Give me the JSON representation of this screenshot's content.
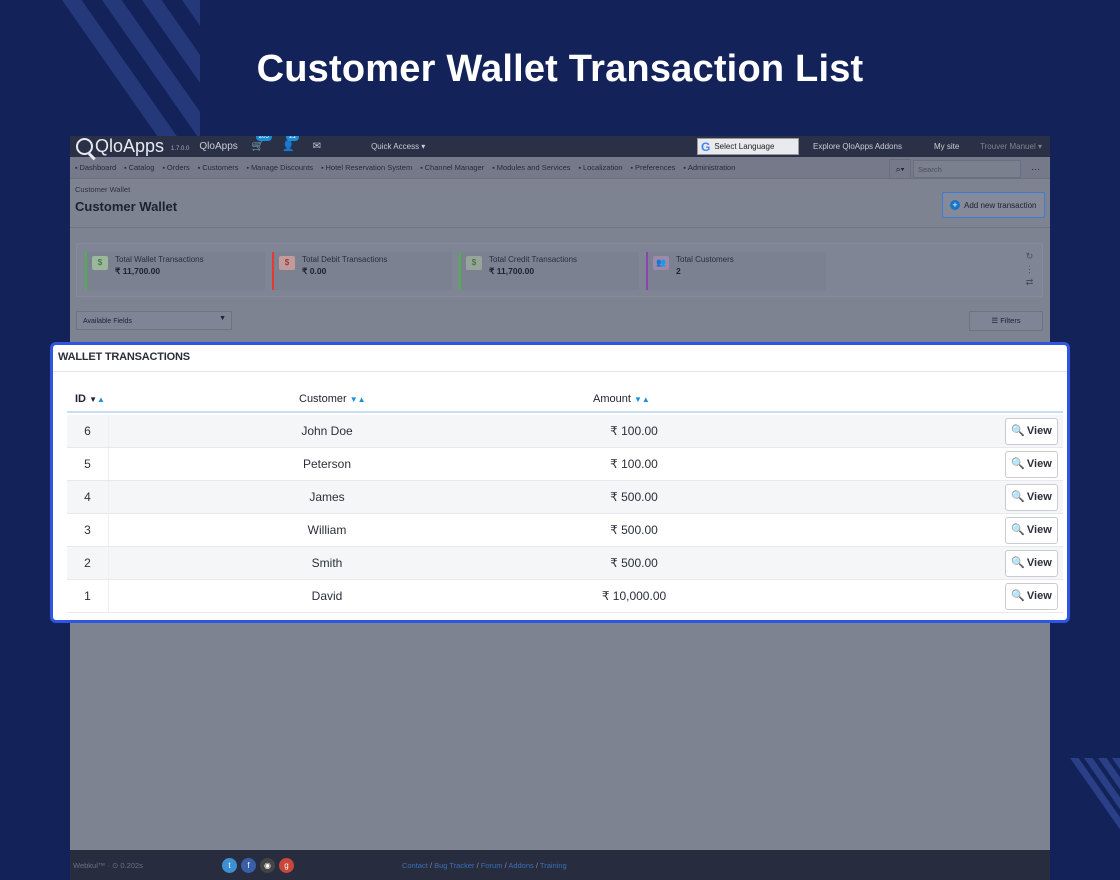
{
  "hero": {
    "title": "Customer Wallet Transaction List"
  },
  "topbar": {
    "logo": "QloApps",
    "version": "1.7.0.0",
    "shop_name": "QloApps",
    "orders_badge": "205",
    "customers_badge": "21",
    "quick_access": "Quick Access ▾",
    "language": "Select Language",
    "explore": "Explore QloApps Addons",
    "my_site": "My site",
    "user": "Trouver Manuel ▾"
  },
  "menu": {
    "items": [
      "Dashboard",
      "Catalog",
      "Orders",
      "Customers",
      "Manage Discounts",
      "Hotel Reservation System",
      "Channel Manager",
      "Modules and Services",
      "Localization",
      "Preferences",
      "Administration"
    ],
    "search_placeholder": "Search",
    "more": "···"
  },
  "page": {
    "breadcrumb": "Customer Wallet",
    "title": "Customer Wallet",
    "add_button": "Add new transaction"
  },
  "kpis": [
    {
      "label": "Total Wallet Transactions",
      "value": "₹ 11,700.00",
      "color": "#4caf50"
    },
    {
      "label": "Total Debit Transactions",
      "value": "₹ 0.00",
      "color": "#e53935"
    },
    {
      "label": "Total Credit Transactions",
      "value": "₹ 11,700.00",
      "color": "#4caf50"
    },
    {
      "label": "Total Customers",
      "value": "2",
      "color": "#8e44ad"
    }
  ],
  "list_tools": {
    "available_fields": "Available Fields",
    "filters": "Filters"
  },
  "card": {
    "title": "WALLET TRANSACTIONS",
    "columns": {
      "id": "ID",
      "customer": "Customer",
      "amount": "Amount"
    },
    "view_label": "View",
    "rows": [
      {
        "id": "6",
        "customer": "John Doe",
        "amount": "₹ 100.00"
      },
      {
        "id": "5",
        "customer": "Peterson",
        "amount": "₹ 100.00"
      },
      {
        "id": "4",
        "customer": "James",
        "amount": "₹ 500.00"
      },
      {
        "id": "3",
        "customer": "William",
        "amount": "₹ 500.00"
      },
      {
        "id": "2",
        "customer": "Smith",
        "amount": "₹ 500.00"
      },
      {
        "id": "1",
        "customer": "David",
        "amount": "₹ 10,000.00"
      }
    ]
  },
  "footer": {
    "brand": "Webkul™ · ⊙ 0.202s",
    "links": [
      "Contact",
      "Bug Tracker",
      "Forum",
      "Addons",
      "Training"
    ]
  },
  "colors": {
    "background": "#13235a",
    "accent": "#2f56e0",
    "link": "#1f8fd4"
  }
}
